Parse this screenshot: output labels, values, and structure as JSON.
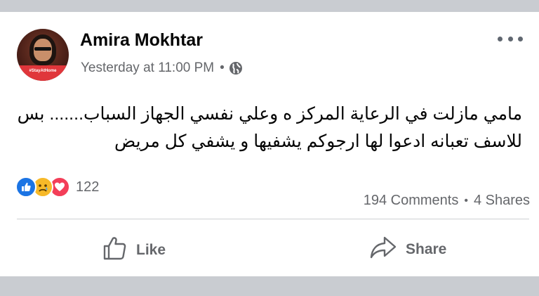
{
  "post": {
    "author": "Amira Mokhtar",
    "timestamp": "Yesterday at 11:00 PM",
    "separator": "•",
    "audience_icon": "globe-icon",
    "avatar_badge": "#StayAtHome",
    "text_line1": "مامي مازلت في الرعاية المركز ه وعلي نفسي الجهاز السباب....... بس",
    "text_line2": "للاسف تعبانه ادعوا لها ارجوكم يشفيها و يشفي كل مريض"
  },
  "reactions": {
    "icons": [
      "like-icon",
      "sad-icon",
      "love-icon"
    ],
    "count": "122"
  },
  "stats": {
    "comments": "194 Comments",
    "separator": "•",
    "shares": "4 Shares"
  },
  "actions": {
    "like_label": "Like",
    "share_label": "Share"
  },
  "colors": {
    "like_blue": "#1b74e4",
    "love_red": "#f33e58",
    "sad_yellow": "#f7b928",
    "secondary_text": "#65676b",
    "background_gray": "#c9ccd1"
  }
}
